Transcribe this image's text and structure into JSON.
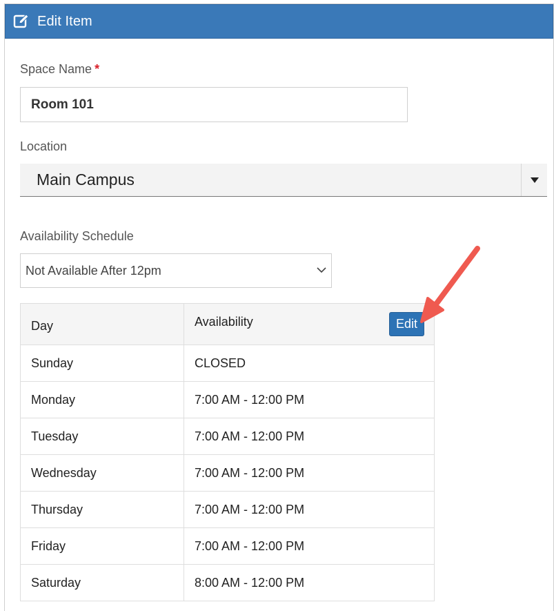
{
  "header": {
    "title": "Edit Item",
    "icon": "edit-icon"
  },
  "form": {
    "space_name": {
      "label": "Space Name",
      "required_marker": "*",
      "value": "Room 101"
    },
    "location": {
      "label": "Location",
      "selected": "Main Campus"
    },
    "availability_schedule": {
      "label": "Availability Schedule",
      "selected": "Not Available After 12pm"
    }
  },
  "table": {
    "headers": {
      "day": "Day",
      "availability": "Availability"
    },
    "edit_label": "Edit",
    "rows": [
      {
        "day": "Sunday",
        "availability": "CLOSED"
      },
      {
        "day": "Monday",
        "availability": "7:00 AM - 12:00 PM"
      },
      {
        "day": "Tuesday",
        "availability": "7:00 AM - 12:00 PM"
      },
      {
        "day": "Wednesday",
        "availability": "7:00 AM - 12:00 PM"
      },
      {
        "day": "Thursday",
        "availability": "7:00 AM - 12:00 PM"
      },
      {
        "day": "Friday",
        "availability": "7:00 AM - 12:00 PM"
      },
      {
        "day": "Saturday",
        "availability": "8:00 AM - 12:00 PM"
      }
    ]
  },
  "colors": {
    "header_bg": "#3a79b8",
    "button_bg": "#2d73b5",
    "required": "#d9202a",
    "annotation_arrow": "#ef5a50"
  }
}
